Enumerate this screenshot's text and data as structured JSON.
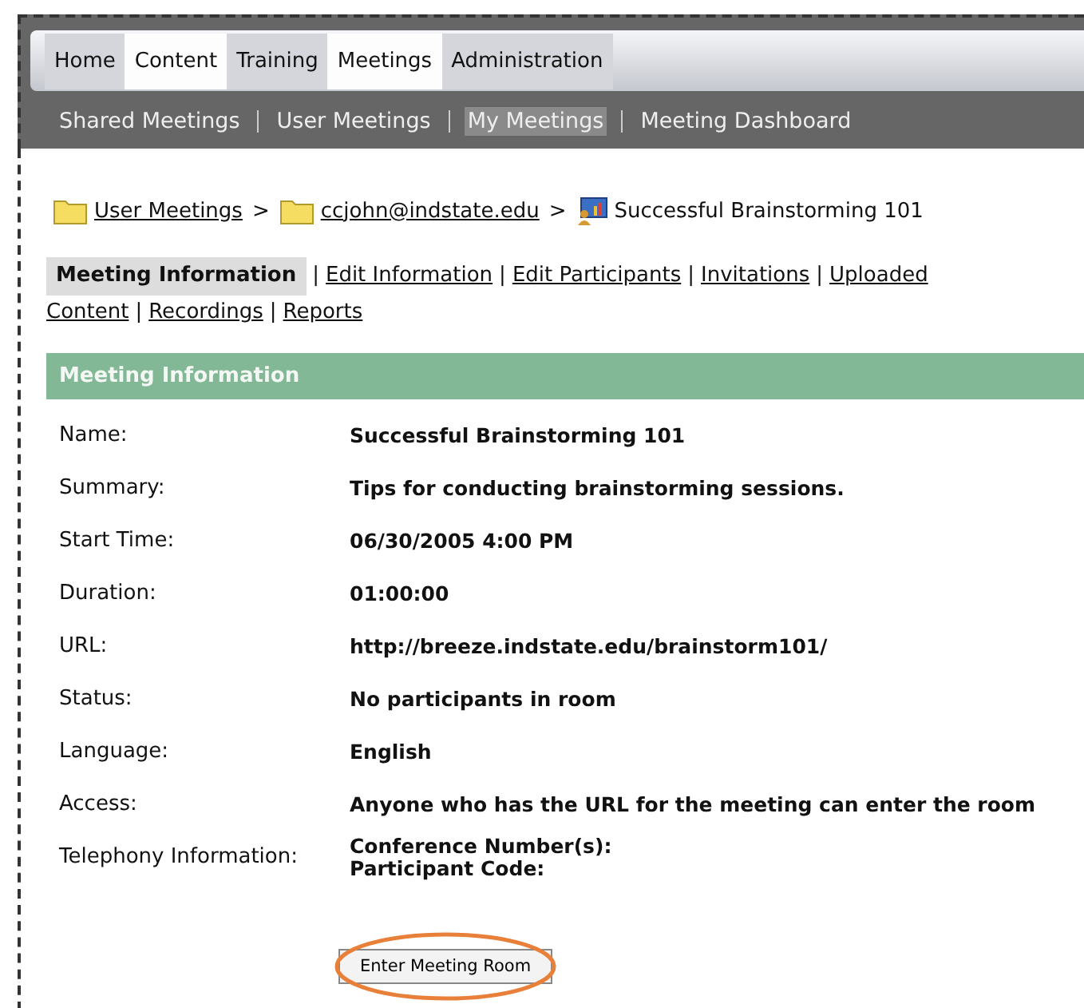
{
  "main_nav": [
    {
      "label": "Home",
      "selected": false
    },
    {
      "label": "Content",
      "selected": true
    },
    {
      "label": "Training",
      "selected": false
    },
    {
      "label": "Meetings",
      "selected": true
    },
    {
      "label": "Administration",
      "selected": false
    }
  ],
  "sub_nav": [
    {
      "label": "Shared Meetings",
      "selected": false
    },
    {
      "label": "User Meetings",
      "selected": false
    },
    {
      "label": "My Meetings",
      "selected": true
    },
    {
      "label": "Meeting Dashboard",
      "selected": false
    }
  ],
  "breadcrumb": [
    {
      "label": "User Meetings",
      "kind": "folder"
    },
    {
      "label": "ccjohn@indstate.edu",
      "kind": "folder"
    },
    {
      "label": "Successful Brainstorming 101",
      "kind": "meeting"
    }
  ],
  "breadcrumb_separator": ">",
  "tab_separator": "|",
  "page_tab_lines": [
    [
      {
        "label": "Meeting Information",
        "selected": true
      },
      {
        "label": "Edit Information",
        "selected": false
      },
      {
        "label": "Edit Participants",
        "selected": false
      },
      {
        "label": "Invitations",
        "selected": false
      },
      {
        "label": "Uploaded",
        "selected": false
      }
    ],
    [
      {
        "label": "Content",
        "selected": false
      },
      {
        "label": "Recordings",
        "selected": false
      },
      {
        "label": "Reports",
        "selected": false
      }
    ]
  ],
  "panel": {
    "title": "Meeting Information",
    "rows": [
      {
        "label": "Name:",
        "value": [
          "Successful Brainstorming 101"
        ]
      },
      {
        "label": "Summary:",
        "value": [
          "Tips for conducting brainstorming sessions."
        ]
      },
      {
        "label": "Start Time:",
        "value": [
          "06/30/2005 4:00 PM"
        ]
      },
      {
        "label": "Duration:",
        "value": [
          "01:00:00"
        ]
      },
      {
        "label": "URL:",
        "value": [
          "http://breeze.indstate.edu/brainstorm101/"
        ]
      },
      {
        "label": "Status:",
        "value": [
          "No participants in room"
        ]
      },
      {
        "label": "Language:",
        "value": [
          "English"
        ]
      },
      {
        "label": "Access:",
        "value": [
          "Anyone who has the URL for the meeting can enter the room"
        ]
      },
      {
        "label": "Telephony Information:",
        "value": [
          "Conference Number(s):",
          "Participant Code:"
        ]
      }
    ]
  },
  "enter_button": {
    "label": "Enter Meeting Room",
    "highlighted": true
  }
}
